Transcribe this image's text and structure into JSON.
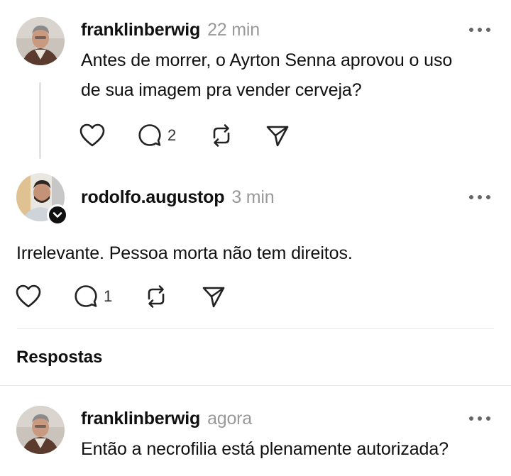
{
  "posts": [
    {
      "username": "franklinberwig",
      "time": "22 min",
      "text_line1": "Antes de morrer, o Ayrton Senna aprovou o uso",
      "text_line2": "de sua imagem pra vender cerveja?",
      "reply_count": "2"
    },
    {
      "username": "rodolfo.augustop",
      "time": "3 min",
      "text": "Irrelevante. Pessoa morta não tem direitos.",
      "reply_count": "1"
    }
  ],
  "replies_header": "Respostas",
  "reply": {
    "username": "franklinberwig",
    "time": "agora",
    "text": "Então a necrofilia está plenamente autorizada?"
  },
  "icons": {
    "like": "heart-icon",
    "comment": "comment-icon",
    "repost": "repost-icon",
    "share": "send-icon",
    "more": "more-icon"
  },
  "colors": {
    "text": "#101010",
    "muted": "#999999",
    "divider": "#e6e6e6"
  }
}
